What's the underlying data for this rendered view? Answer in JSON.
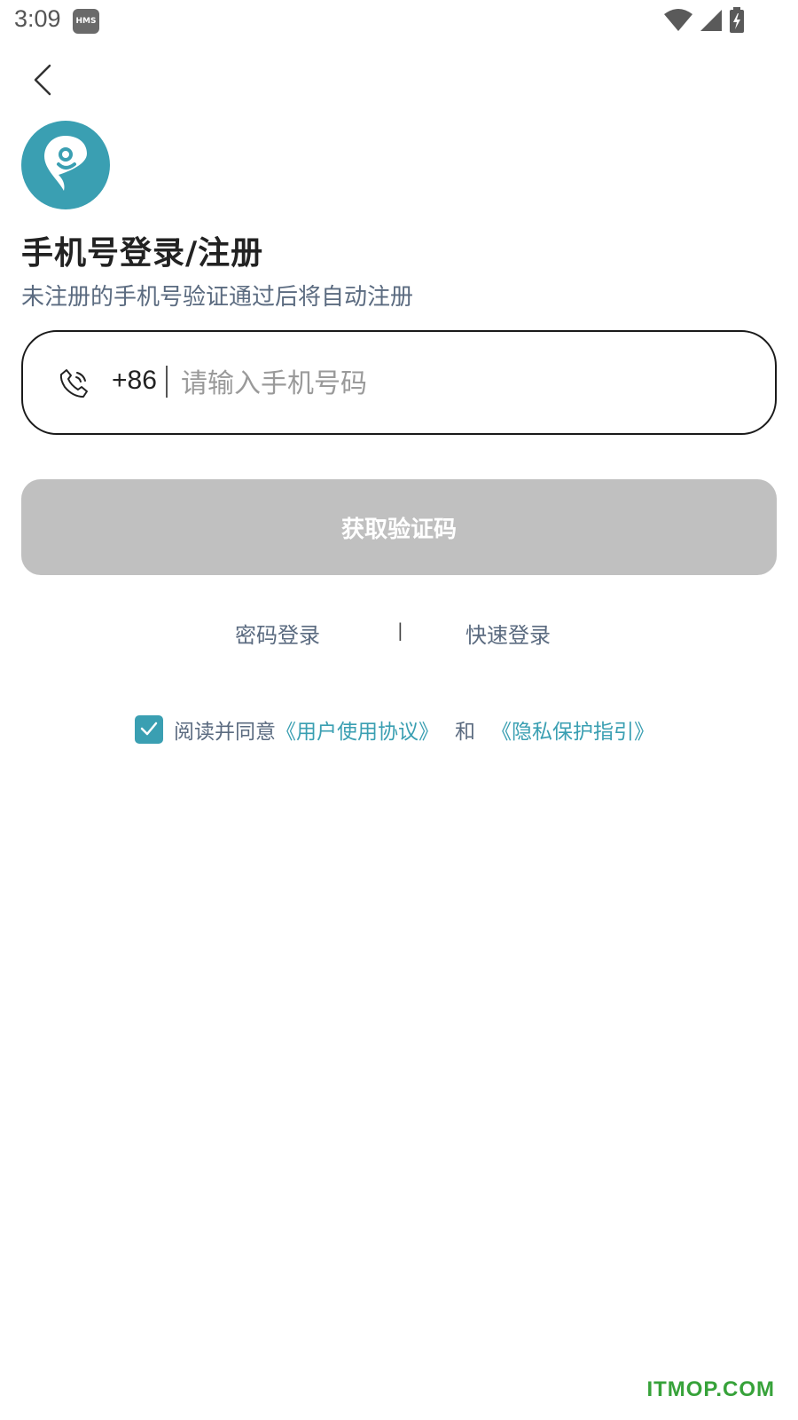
{
  "status_bar": {
    "time": "3:09",
    "badge": "HMS",
    "icons": [
      "wifi-icon",
      "signal-icon",
      "battery-charging-icon"
    ]
  },
  "nav": {
    "back_icon": "chevron-left-icon"
  },
  "brand": {
    "logo_icon": "location-pin-icon",
    "accent_color": "#3a9fb2"
  },
  "header": {
    "title": "手机号登录/注册",
    "subtitle": "未注册的手机号验证通过后将自动注册"
  },
  "phone_field": {
    "icon": "phone-icon",
    "country_code": "+86",
    "value": "",
    "placeholder": "请输入手机号码"
  },
  "primary_button": {
    "label": "获取验证码",
    "state": "disabled",
    "color": "#c0c0c0"
  },
  "alt_login": {
    "password_login": "密码登录",
    "divider": "|",
    "quick_login": "快速登录"
  },
  "agreement": {
    "checked": true,
    "prefix": "阅读并同意",
    "user_agreement": "《用户使用协议》",
    "and": "和",
    "privacy_policy": "《隐私保护指引》"
  },
  "watermark": {
    "text": "ITMOP.COM",
    "color": "#37a23a"
  }
}
